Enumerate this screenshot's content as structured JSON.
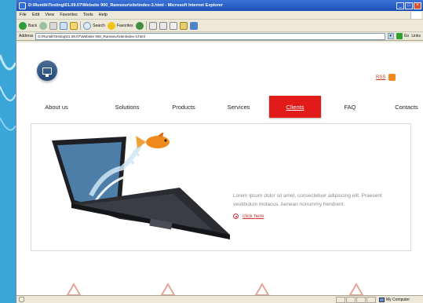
{
  "window": {
    "title": "D:\\Runtik\\Testing\\01.09.07\\Website 900_Ramseur\\site\\index-3.html - Microsoft Internet Explorer"
  },
  "menu": [
    "File",
    "Edit",
    "View",
    "Favorites",
    "Tools",
    "Help"
  ],
  "toolbar": {
    "back_label": "Back",
    "search_label": "Search",
    "favorites_label": "Favorites"
  },
  "address": {
    "label": "Address",
    "value": "D:\\Runtik\\Testing\\01.09.07\\Website 900_Ramseur\\site\\index-3.html",
    "go_label": "Go",
    "links_label": "Links"
  },
  "page": {
    "rss_label": "RSS",
    "nav": [
      "About us",
      "Solutions",
      "Products",
      "Services",
      "Clients",
      "FAQ",
      "Contacts"
    ],
    "active_nav": "Clients",
    "body_text": "Lorem ipsum dolor sit amet, consectetuer adipiscing elit. Praesent vestibulum molacus. Aenean nonummy hendrerit.",
    "link_label": "click here"
  },
  "status": {
    "zone_label": "My Computer"
  },
  "colors": {
    "accent": "#e11a1a",
    "link": "#c33333",
    "titlebar": "#1c4fb6"
  }
}
